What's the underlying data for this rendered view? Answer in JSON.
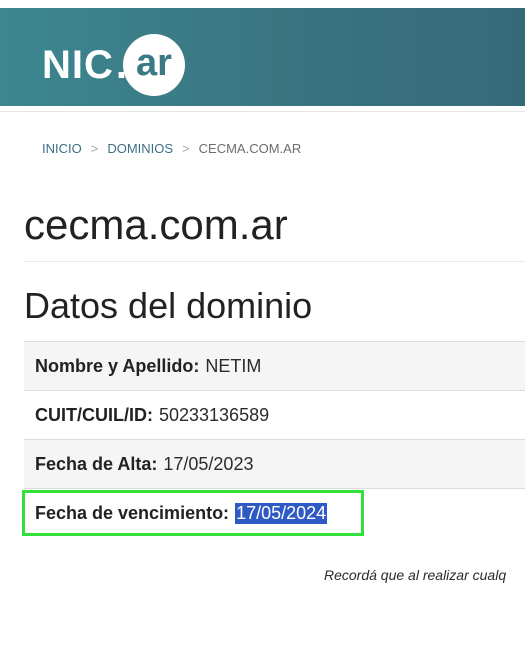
{
  "header": {
    "logo_nic": "NIC",
    "logo_dot": ".",
    "logo_ar": "ar",
    "background": "#3a7480"
  },
  "breadcrumb": {
    "items": [
      "INICIO",
      "DOMINIOS",
      "CECMA.COM.AR"
    ],
    "separator": ">"
  },
  "domain": {
    "name": "cecma.com.ar"
  },
  "section": {
    "title": "Datos del dominio"
  },
  "fields": [
    {
      "label": "Nombre y Apellido:",
      "value": "NETIM"
    },
    {
      "label": "CUIT/CUIL/ID:",
      "value": "50233136589"
    },
    {
      "label": "Fecha de Alta:",
      "value": "17/05/2023"
    },
    {
      "label": "Fecha de vencimiento:",
      "value": "17/05/2024",
      "selected": true
    }
  ],
  "footnote": "Recordá que al realizar cualq",
  "colors": {
    "highlight": "#34e13a",
    "selection": "#2f59c4",
    "link": "#3d6f84"
  }
}
